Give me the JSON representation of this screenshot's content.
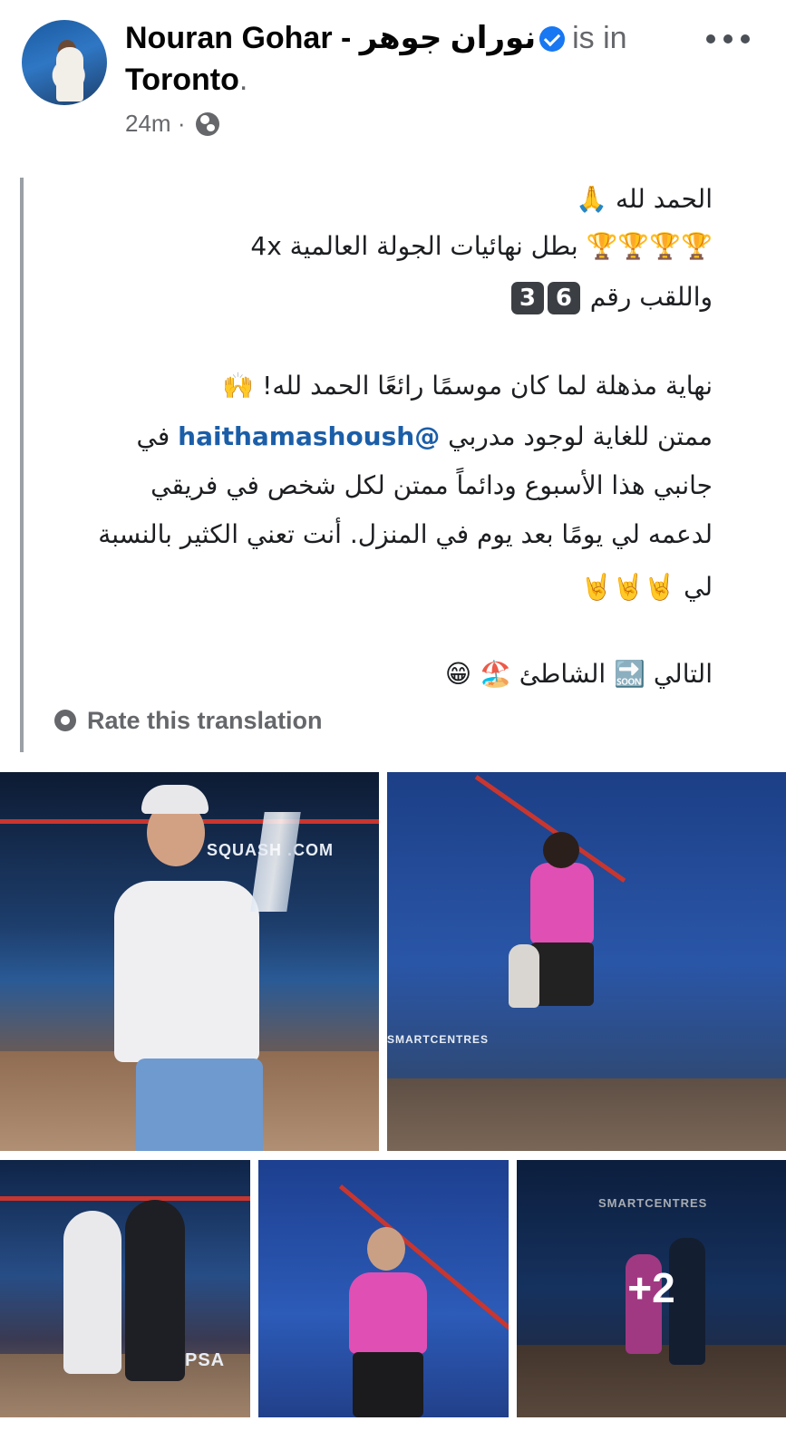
{
  "post": {
    "author_name": "Nouran Gohar - نوران جوهر",
    "status_text": "is in",
    "location": "Toronto",
    "location_dot": ".",
    "time": "24m",
    "time_sep": "·",
    "privacy_icon": "globe-icon",
    "more_icon": "more-dots-icon",
    "verified_icon": "verified-badge-icon"
  },
  "body": {
    "line1": "الحمد لله 🙏",
    "line2": "🏆🏆🏆🏆 بطل نهائيات الجولة العالمية 4x",
    "line3_text": "واللقب رقم",
    "line3_badges": [
      "3",
      "6"
    ],
    "line4": "نهاية مذهلة لما كان موسمًا رائعًا الحمد لله! 🙌",
    "line5_before": "ممتن للغاية لوجود مدربي ",
    "line5_mention": "@haithamashoush",
    "line5_after": " في",
    "line6": "جانبي هذا الأسبوع ودائماً ممتن لكل شخص في فريقي",
    "line7": "لدعمه لي يومًا بعد يوم في المنزل. أنت تعني الكثير بالنسبة",
    "line8": "لي 🤘🤘🤘",
    "line9": "التالي 🔜 الشاطئ 🏖️ 😁",
    "rate_translation": "Rate this translation",
    "rate_icon": "gear-icon"
  },
  "photos": {
    "p1_sign": "SQUASH   .COM",
    "p2_sign": "SMARTCENTRES",
    "p5_sign": "SMARTCENTRES",
    "p3_sign": "PSA",
    "more_count": "+2"
  }
}
